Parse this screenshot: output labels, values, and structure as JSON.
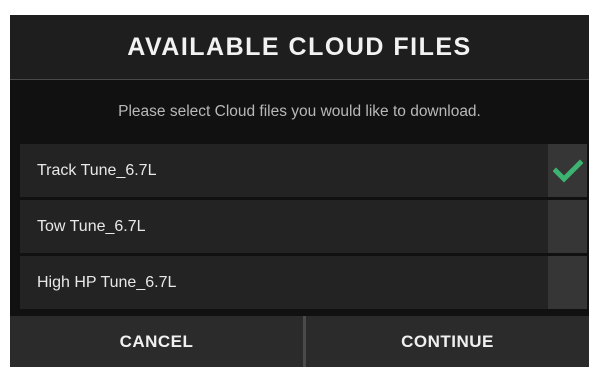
{
  "dialog": {
    "title": "AVAILABLE CLOUD FILES",
    "subtitle": "Please select Cloud files you would like to download.",
    "accent_color": "#3cb371",
    "files": [
      {
        "name": "Track Tune_6.7L",
        "selected": true
      },
      {
        "name": "Tow Tune_6.7L",
        "selected": false
      },
      {
        "name": "High HP Tune_6.7L",
        "selected": false
      }
    ],
    "check_icon": "check-icon",
    "cancel_label": "CANCEL",
    "continue_label": "CONTINUE"
  }
}
